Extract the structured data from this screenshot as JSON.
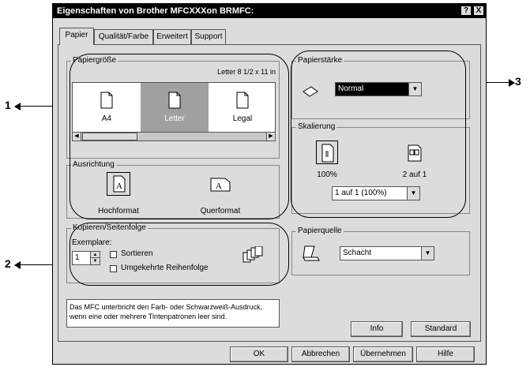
{
  "window": {
    "title": "Eigenschaften von Brother MFCXXXon BRMFC:",
    "help_btn": "?",
    "close_btn": "X"
  },
  "tabs": [
    "Papier",
    "Qualität/Farbe",
    "Erweitert",
    "Support"
  ],
  "papiergroesse": {
    "label": "Papiergröße",
    "selected_size": "Letter 8 1/2 x 11 in",
    "items": [
      "A4",
      "Letter",
      "Legal"
    ],
    "selected_item": "Letter"
  },
  "ausrichtung": {
    "label": "Ausrichtung",
    "options": [
      "Hochformat",
      "Querformat"
    ],
    "selected": "Hochformat"
  },
  "kopieren": {
    "label": "Kopieren/Seitenfolge",
    "exemplare_label": "Exemplare:",
    "exemplare_value": "1",
    "sortieren": "Sortieren",
    "reihenfolge": "Umgekehrte Reihenfolge"
  },
  "papierstaerke": {
    "label": "Papierstärke",
    "value": "Normal"
  },
  "skalierung": {
    "label": "Skalierung",
    "opt1": "100%",
    "opt2": "2 auf 1",
    "value": "1 auf 1 (100%)"
  },
  "papierquelle": {
    "label": "Papierquelle",
    "value": "Schacht"
  },
  "info_text": "Das MFC unterbricht den Farb- oder Schwarzweiß-Ausdruck, wenn eine oder mehrere Tintenpatronen leer sind.",
  "buttons": {
    "info": "Info",
    "standard": "Standard",
    "ok": "OK",
    "abbrechen": "Abbrechen",
    "uebernehmen": "Übernehmen",
    "hilfe": "Hilfe"
  },
  "callouts": [
    "1",
    "2",
    "3"
  ]
}
